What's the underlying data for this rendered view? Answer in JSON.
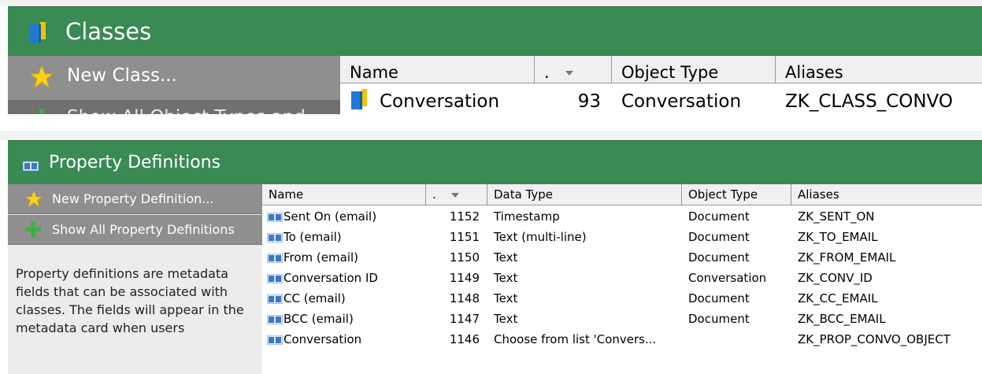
{
  "classes_panel": {
    "title": "Classes",
    "new_class_label": "New Class...",
    "show_all_label": "Show All Object Types and ...",
    "columns": [
      "Name",
      ".",
      "Object Type",
      "Aliases"
    ],
    "rows": [
      {
        "name": "Conversation",
        "id": "93",
        "object_type": "Conversation",
        "aliases": "ZK_CLASS_CONVO"
      }
    ]
  },
  "property_panel": {
    "title": "Property Definitions",
    "new_label": "New Property Definition...",
    "show_all_label": "Show All Property Definitions",
    "description": "Property definitions are metadata fields that can be associated with classes. The fields will appear in the metadata card when users",
    "columns": [
      "Name",
      ".",
      "Data Type",
      "Object Type",
      "Aliases"
    ],
    "rows": [
      {
        "name": "Sent On (email)",
        "id": "1152",
        "data_type": "Timestamp",
        "object_type": "Document",
        "aliases": "ZK_SENT_ON"
      },
      {
        "name": "To (email)",
        "id": "1151",
        "data_type": "Text (multi-line)",
        "object_type": "Document",
        "aliases": "ZK_TO_EMAIL"
      },
      {
        "name": "From (email)",
        "id": "1150",
        "data_type": "Text",
        "object_type": "Document",
        "aliases": "ZK_FROM_EMAIL"
      },
      {
        "name": "Conversation ID",
        "id": "1149",
        "data_type": "Text",
        "object_type": "Conversation",
        "aliases": "ZK_CONV_ID"
      },
      {
        "name": "CC (email)",
        "id": "1148",
        "data_type": "Text",
        "object_type": "Document",
        "aliases": "ZK_CC_EMAIL"
      },
      {
        "name": "BCC (email)",
        "id": "1147",
        "data_type": "Text",
        "object_type": "Document",
        "aliases": "ZK_BCC_EMAIL"
      },
      {
        "name": "Conversation",
        "id": "1146",
        "data_type": "Choose from list 'Convers...",
        "object_type": "",
        "aliases": "ZK_PROP_CONVO_OBJECT"
      }
    ]
  },
  "colors": {
    "header_green": "#3a8a53",
    "side_gray": "#8f8f8f",
    "icon_blue": "#1f7ad6"
  },
  "icons": [
    "book-icon",
    "star-icon",
    "plus-icon",
    "metadata-icon",
    "class-icon",
    "sort-desc-icon"
  ]
}
